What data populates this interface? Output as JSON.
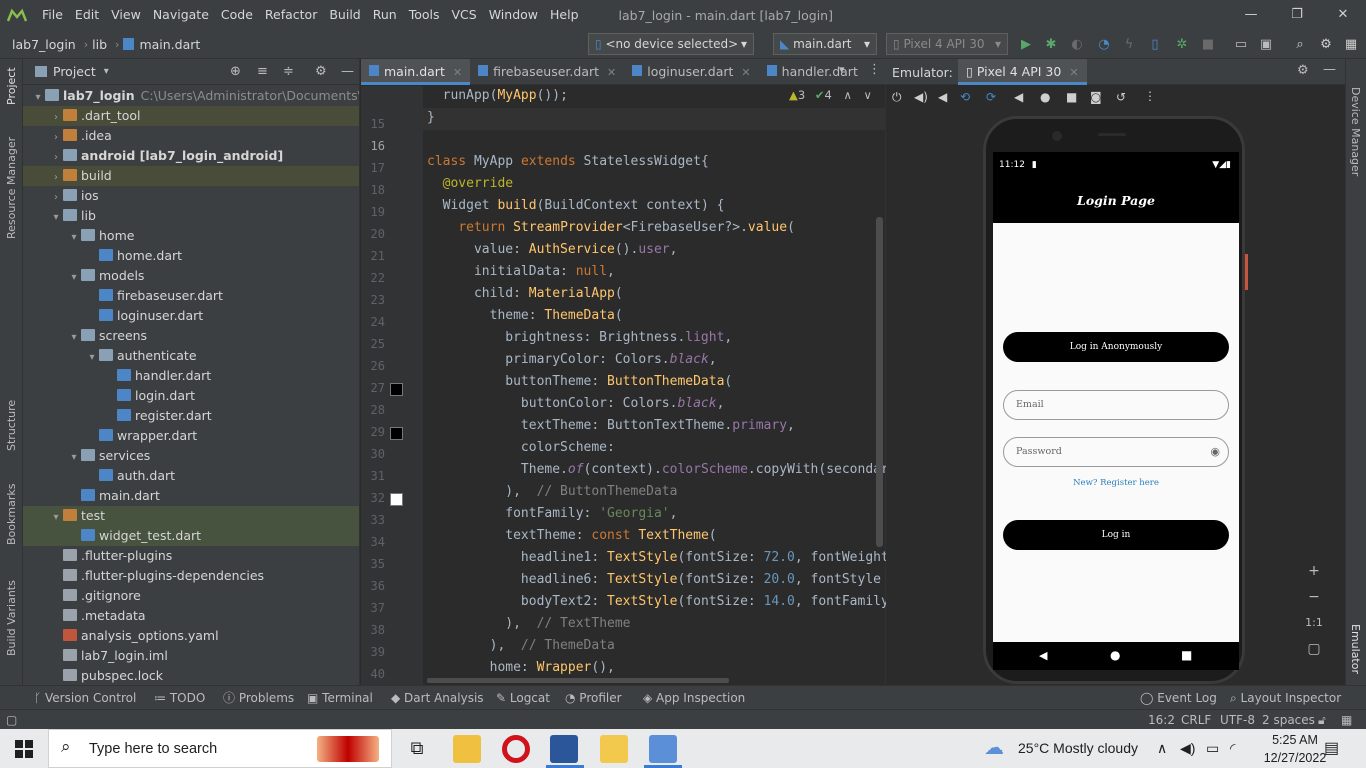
{
  "window": {
    "title": "lab7_login - main.dart [lab7_login]",
    "menu": [
      "File",
      "Edit",
      "View",
      "Navigate",
      "Code",
      "Refactor",
      "Build",
      "Run",
      "Tools",
      "VCS",
      "Window",
      "Help"
    ],
    "controls": [
      "—",
      "❐",
      "✕"
    ]
  },
  "breadcrumb": {
    "project": "lab7_login",
    "folder": "lib",
    "file": "main.dart"
  },
  "toolbar": {
    "device_selector": "<no device selected>",
    "run_config": "main.dart",
    "avd": "Pixel 4 API 30"
  },
  "project_panel": {
    "title": "Project",
    "tree": [
      {
        "label": "lab7_login",
        "path": "C:\\Users\\Administrator\\Documents\\GitHub\\",
        "indent": 0,
        "arrow": "▾",
        "icon": "folder",
        "bold": true
      },
      {
        "label": ".dart_tool",
        "indent": 1,
        "arrow": "›",
        "icon": "folder-orange",
        "hl": "row-hl"
      },
      {
        "label": ".idea",
        "indent": 1,
        "arrow": "›",
        "icon": "folder-orange"
      },
      {
        "label": "android [lab7_login_android]",
        "indent": 1,
        "arrow": "›",
        "icon": "folder",
        "bold": true
      },
      {
        "label": "build",
        "indent": 1,
        "arrow": "›",
        "icon": "folder-orange",
        "hl": "row-hl"
      },
      {
        "label": "ios",
        "indent": 1,
        "arrow": "›",
        "icon": "folder"
      },
      {
        "label": "lib",
        "indent": 1,
        "arrow": "▾",
        "icon": "folder"
      },
      {
        "label": "home",
        "indent": 2,
        "arrow": "▾",
        "icon": "folder"
      },
      {
        "label": "home.dart",
        "indent": 3,
        "arrow": "",
        "icon": "file-dart"
      },
      {
        "label": "models",
        "indent": 2,
        "arrow": "▾",
        "icon": "folder"
      },
      {
        "label": "firebaseuser.dart",
        "indent": 3,
        "arrow": "",
        "icon": "file-dart"
      },
      {
        "label": "loginuser.dart",
        "indent": 3,
        "arrow": "",
        "icon": "file-dart"
      },
      {
        "label": "screens",
        "indent": 2,
        "arrow": "▾",
        "icon": "folder"
      },
      {
        "label": "authenticate",
        "indent": 3,
        "arrow": "▾",
        "icon": "folder"
      },
      {
        "label": "handler.dart",
        "indent": 4,
        "arrow": "",
        "icon": "file-dart"
      },
      {
        "label": "login.dart",
        "indent": 4,
        "arrow": "",
        "icon": "file-dart"
      },
      {
        "label": "register.dart",
        "indent": 4,
        "arrow": "",
        "icon": "file-dart"
      },
      {
        "label": "wrapper.dart",
        "indent": 3,
        "arrow": "",
        "icon": "file-dart"
      },
      {
        "label": "services",
        "indent": 2,
        "arrow": "▾",
        "icon": "folder"
      },
      {
        "label": "auth.dart",
        "indent": 3,
        "arrow": "",
        "icon": "file-dart"
      },
      {
        "label": "main.dart",
        "indent": 2,
        "arrow": "",
        "icon": "file-dart"
      },
      {
        "label": "test",
        "indent": 1,
        "arrow": "▾",
        "icon": "folder-orange",
        "hl": "row-green"
      },
      {
        "label": "widget_test.dart",
        "indent": 2,
        "arrow": "",
        "icon": "file-dart",
        "hl": "row-green"
      },
      {
        "label": ".flutter-plugins",
        "indent": 1,
        "arrow": "",
        "icon": "file-plain"
      },
      {
        "label": ".flutter-plugins-dependencies",
        "indent": 1,
        "arrow": "",
        "icon": "file-plain"
      },
      {
        "label": ".gitignore",
        "indent": 1,
        "arrow": "",
        "icon": "file-plain"
      },
      {
        "label": ".metadata",
        "indent": 1,
        "arrow": "",
        "icon": "file-plain"
      },
      {
        "label": "analysis_options.yaml",
        "indent": 1,
        "arrow": "",
        "icon": "file-yaml"
      },
      {
        "label": "lab7_login.iml",
        "indent": 1,
        "arrow": "",
        "icon": "file-plain"
      },
      {
        "label": "pubspec.lock",
        "indent": 1,
        "arrow": "",
        "icon": "file-plain"
      }
    ]
  },
  "left_stripe": [
    "Project",
    "Resource Manager",
    "Structure",
    "Bookmarks",
    "Build Variants"
  ],
  "right_stripe": [
    "Device Manager",
    "Emulator"
  ],
  "editor": {
    "tabs": [
      "main.dart",
      "firebaseuser.dart",
      "loginuser.dart",
      "handler.dart"
    ],
    "inspections": {
      "warnings": "3",
      "checks": "4"
    },
    "line_numbers": [
      "15",
      "16",
      "17",
      "18",
      "19",
      "20",
      "21",
      "22",
      "23",
      "24",
      "25",
      "26",
      "27",
      "28",
      "29",
      "30",
      "31",
      "32",
      "33",
      "34",
      "35",
      "36",
      "37",
      "38",
      "39",
      "40",
      "41"
    ]
  },
  "emulator": {
    "header_label": "Emulator:",
    "device_tab": "Pixel 4 API 30",
    "phone": {
      "time": "11:12",
      "app_title": "Login Page",
      "anon_button": "Log in Anonymously",
      "email_placeholder": "Email",
      "password_placeholder": "Password",
      "register_link": "New? Register here",
      "login_button": "Log in"
    },
    "zoom_labels": [
      "+",
      "−",
      "1:1"
    ]
  },
  "bottom_tools": [
    "Version Control",
    "TODO",
    "Problems",
    "Terminal",
    "Dart Analysis",
    "Logcat",
    "Profiler",
    "App Inspection"
  ],
  "bottom_tools_right": [
    "Event Log",
    "Layout Inspector"
  ],
  "status": {
    "position": "16:2",
    "line_sep": "CRLF",
    "encoding": "UTF-8",
    "indent": "2 spaces"
  },
  "taskbar": {
    "search_placeholder": "Type here to search",
    "weather": "25°C  Mostly cloudy",
    "time": "5:25 AM",
    "date": "12/27/2022"
  },
  "colors": {
    "accent": "#4a88c7",
    "run_green": "#59a869",
    "keyword": "#cc7832",
    "string": "#6a8759"
  }
}
